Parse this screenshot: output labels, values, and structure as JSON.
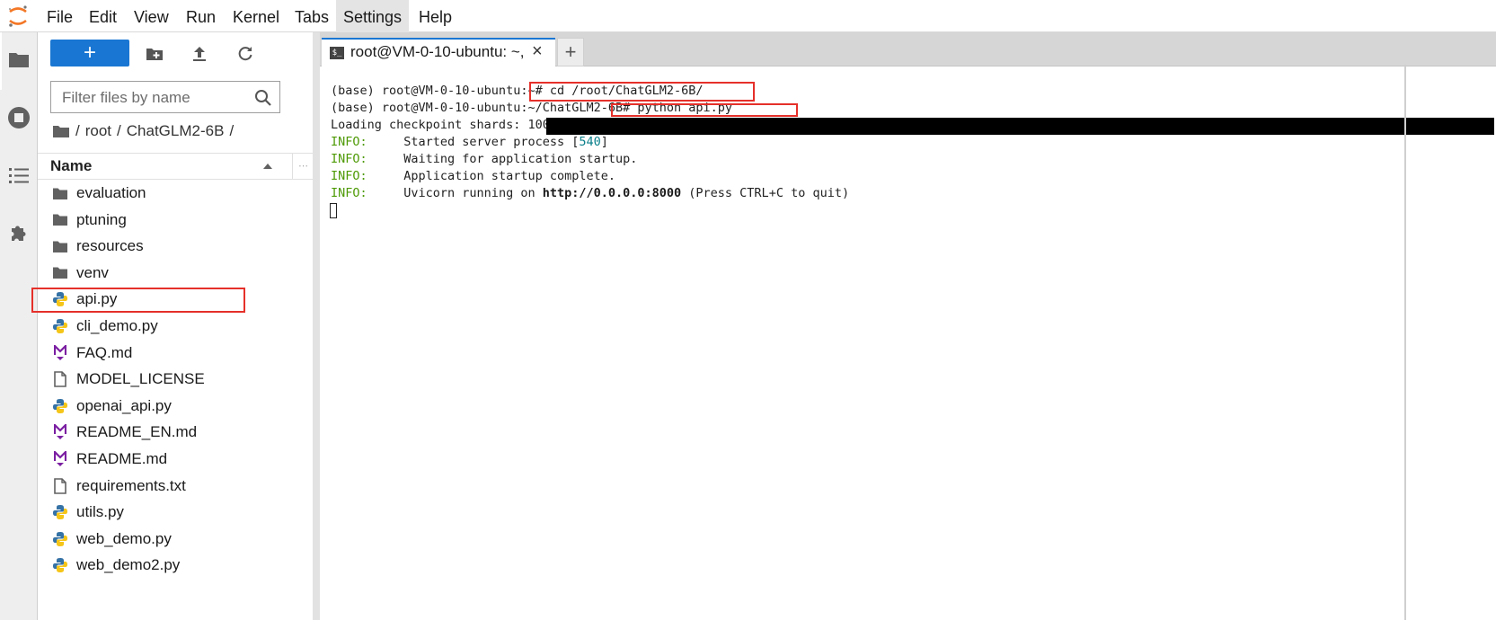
{
  "menubar": {
    "items": [
      "File",
      "Edit",
      "View",
      "Run",
      "Kernel",
      "Tabs",
      "Settings",
      "Help"
    ],
    "active": "Settings"
  },
  "activitybar": {
    "icons": [
      "folder-icon",
      "stop-circle-icon",
      "list-icon",
      "puzzle-icon"
    ]
  },
  "filebrowser": {
    "new_label": "+",
    "filter_placeholder": "Filter files by name",
    "breadcrumb": [
      "/",
      "root",
      "/",
      "ChatGLM2-6B",
      "/"
    ],
    "header_name": "Name",
    "header_more": "⋯",
    "files": [
      {
        "name": "evaluation",
        "type": "folder"
      },
      {
        "name": "ptuning",
        "type": "folder"
      },
      {
        "name": "resources",
        "type": "folder"
      },
      {
        "name": "venv",
        "type": "folder"
      },
      {
        "name": "api.py",
        "type": "python"
      },
      {
        "name": "cli_demo.py",
        "type": "python"
      },
      {
        "name": "FAQ.md",
        "type": "markdown"
      },
      {
        "name": "MODEL_LICENSE",
        "type": "file"
      },
      {
        "name": "openai_api.py",
        "type": "python"
      },
      {
        "name": "README_EN.md",
        "type": "markdown"
      },
      {
        "name": "README.md",
        "type": "markdown"
      },
      {
        "name": "requirements.txt",
        "type": "file"
      },
      {
        "name": "utils.py",
        "type": "python"
      },
      {
        "name": "web_demo.py",
        "type": "python"
      },
      {
        "name": "web_demo2.py",
        "type": "python"
      }
    ]
  },
  "tabs": {
    "terminal_tab_label": "root@VM-0-10-ubuntu: ~,",
    "terminal_icon_text": "$_",
    "close": "×",
    "add": "+"
  },
  "terminal": {
    "line1_prompt": "(base) root@VM-0-10-ubuntu:~# ",
    "line1_cmd": "cd /root/ChatGLM2-6B/",
    "line2_prompt": "(base) root@VM-0-10-ubuntu:~/ChatGLM2-6B# ",
    "line2_cmd": "python api.py",
    "line3": "Loading checkpoint shards: 100%|",
    "line3_progress": 1.0,
    "info_tag": "INFO:",
    "line4_text": "     Started server process [",
    "line4_pid": "540",
    "line4_end": "]",
    "line5_text": "     Waiting for application startup.",
    "line6_text": "     Application startup complete.",
    "line7_text": "     Uvicorn running on ",
    "line7_url": "http://0.0.0.0:8000",
    "line7_end": " (Press CTRL+C to quit)"
  },
  "colors": {
    "accent": "#1976d2",
    "highlight": "#e5302a",
    "info": "#4e9a06",
    "markdown": "#7b1fa2",
    "python_blue": "#3572a5",
    "python_yellow": "#f5c518"
  }
}
